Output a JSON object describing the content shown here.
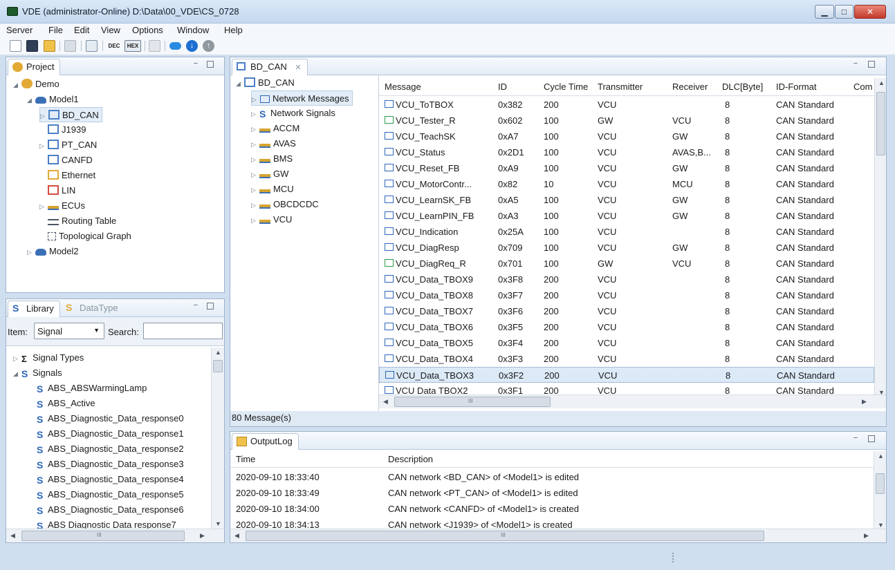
{
  "window": {
    "title": "VDE (administrator-Online)  D:\\Data\\00_VDE\\CS_0728"
  },
  "menubar": [
    "Server",
    "File",
    "Edit",
    "View",
    "Options",
    "Window",
    "Help"
  ],
  "toolbar": {
    "dec_label": "DEC",
    "hex_label": "HEX"
  },
  "project": {
    "tab_label": "Project",
    "items": [
      {
        "label": "Demo",
        "expander": "◢"
      },
      {
        "label": "Model1",
        "expander": "◢"
      },
      {
        "label": "BD_CAN",
        "expander": "▷"
      },
      {
        "label": "J1939",
        "expander": ""
      },
      {
        "label": "PT_CAN",
        "expander": "▷"
      },
      {
        "label": "CANFD",
        "expander": ""
      },
      {
        "label": "Ethernet",
        "expander": ""
      },
      {
        "label": "LIN",
        "expander": ""
      },
      {
        "label": "ECUs",
        "expander": "▷"
      },
      {
        "label": "Routing Table",
        "expander": ""
      },
      {
        "label": "Topological Graph",
        "expander": ""
      },
      {
        "label": "Model2",
        "expander": "▷"
      }
    ]
  },
  "library": {
    "tab_label": "Library",
    "datatype_tab_label": "DataType",
    "item_label": "Item:",
    "item_value": "Signal",
    "search_label": "Search:",
    "search_value": "",
    "tree": [
      {
        "label": "Signal Types",
        "expander": "▷"
      },
      {
        "label": "Signals",
        "expander": "◢"
      }
    ],
    "signals": [
      "ABS_ABSWarmingLamp",
      "ABS_Active",
      "ABS_Diagnostic_Data_response0",
      "ABS_Diagnostic_Data_response1",
      "ABS_Diagnostic_Data_response2",
      "ABS_Diagnostic_Data_response3",
      "ABS_Diagnostic_Data_response4",
      "ABS_Diagnostic_Data_response5",
      "ABS_Diagnostic_Data_response6",
      "ABS Diagnostic Data response7"
    ]
  },
  "editor": {
    "tab_label": "BD_CAN",
    "tree_root": "BD_CAN",
    "tree": [
      {
        "label": "Network Messages",
        "expander": "▷"
      },
      {
        "label": "Network Signals",
        "expander": "▷"
      },
      {
        "label": "ACCM",
        "expander": "▷"
      },
      {
        "label": "AVAS",
        "expander": "▷"
      },
      {
        "label": "BMS",
        "expander": "▷"
      },
      {
        "label": "GW",
        "expander": "▷"
      },
      {
        "label": "MCU",
        "expander": "▷"
      },
      {
        "label": "OBCDCDC",
        "expander": "▷"
      },
      {
        "label": "VCU",
        "expander": "▷"
      }
    ],
    "columns": [
      "Message",
      "ID",
      "Cycle Time",
      "Transmitter",
      "Receiver",
      "DLC[Byte]",
      "ID-Format",
      "Com"
    ],
    "rows": [
      {
        "message": "VCU_ToTBOX",
        "id": "0x382",
        "cycle": "200",
        "tx": "VCU",
        "rx": "",
        "dlc": "8",
        "fmt": "CAN Standard"
      },
      {
        "message": "VCU_Tester_R",
        "id": "0x602",
        "cycle": "100",
        "tx": "GW",
        "rx": "VCU",
        "dlc": "8",
        "fmt": "CAN Standard"
      },
      {
        "message": "VCU_TeachSK",
        "id": "0xA7",
        "cycle": "100",
        "tx": "VCU",
        "rx": "GW",
        "dlc": "8",
        "fmt": "CAN Standard"
      },
      {
        "message": "VCU_Status",
        "id": "0x2D1",
        "cycle": "100",
        "tx": "VCU",
        "rx": "AVAS,B...",
        "dlc": "8",
        "fmt": "CAN Standard"
      },
      {
        "message": "VCU_Reset_FB",
        "id": "0xA9",
        "cycle": "100",
        "tx": "VCU",
        "rx": "GW",
        "dlc": "8",
        "fmt": "CAN Standard"
      },
      {
        "message": "VCU_MotorContr...",
        "id": "0x82",
        "cycle": "10",
        "tx": "VCU",
        "rx": "MCU",
        "dlc": "8",
        "fmt": "CAN Standard"
      },
      {
        "message": "VCU_LearnSK_FB",
        "id": "0xA5",
        "cycle": "100",
        "tx": "VCU",
        "rx": "GW",
        "dlc": "8",
        "fmt": "CAN Standard"
      },
      {
        "message": "VCU_LearnPIN_FB",
        "id": "0xA3",
        "cycle": "100",
        "tx": "VCU",
        "rx": "GW",
        "dlc": "8",
        "fmt": "CAN Standard"
      },
      {
        "message": "VCU_Indication",
        "id": "0x25A",
        "cycle": "100",
        "tx": "VCU",
        "rx": "",
        "dlc": "8",
        "fmt": "CAN Standard"
      },
      {
        "message": "VCU_DiagResp",
        "id": "0x709",
        "cycle": "100",
        "tx": "VCU",
        "rx": "GW",
        "dlc": "8",
        "fmt": "CAN Standard"
      },
      {
        "message": "VCU_DiagReq_R",
        "id": "0x701",
        "cycle": "100",
        "tx": "GW",
        "rx": "VCU",
        "dlc": "8",
        "fmt": "CAN Standard"
      },
      {
        "message": "VCU_Data_TBOX9",
        "id": "0x3F8",
        "cycle": "200",
        "tx": "VCU",
        "rx": "",
        "dlc": "8",
        "fmt": "CAN Standard"
      },
      {
        "message": "VCU_Data_TBOX8",
        "id": "0x3F7",
        "cycle": "200",
        "tx": "VCU",
        "rx": "",
        "dlc": "8",
        "fmt": "CAN Standard"
      },
      {
        "message": "VCU_Data_TBOX7",
        "id": "0x3F6",
        "cycle": "200",
        "tx": "VCU",
        "rx": "",
        "dlc": "8",
        "fmt": "CAN Standard"
      },
      {
        "message": "VCU_Data_TBOX6",
        "id": "0x3F5",
        "cycle": "200",
        "tx": "VCU",
        "rx": "",
        "dlc": "8",
        "fmt": "CAN Standard"
      },
      {
        "message": "VCU_Data_TBOX5",
        "id": "0x3F4",
        "cycle": "200",
        "tx": "VCU",
        "rx": "",
        "dlc": "8",
        "fmt": "CAN Standard"
      },
      {
        "message": "VCU_Data_TBOX4",
        "id": "0x3F3",
        "cycle": "200",
        "tx": "VCU",
        "rx": "",
        "dlc": "8",
        "fmt": "CAN Standard"
      },
      {
        "message": "VCU_Data_TBOX3",
        "id": "0x3F2",
        "cycle": "200",
        "tx": "VCU",
        "rx": "",
        "dlc": "8",
        "fmt": "CAN Standard"
      },
      {
        "message": "VCU Data TBOX2",
        "id": "0x3F1",
        "cycle": "200",
        "tx": "VCU",
        "rx": "",
        "dlc": "8",
        "fmt": "CAN Standard"
      }
    ],
    "selected_row_index": 17,
    "status": "80 Message(s)"
  },
  "outputlog": {
    "tab_label": "OutputLog",
    "columns": [
      "Time",
      "Description"
    ],
    "rows": [
      {
        "time": "2020-09-10 18:33:40",
        "desc": "CAN network <BD_CAN> of <Model1> is edited"
      },
      {
        "time": "2020-09-10 18:33:49",
        "desc": "CAN network <PT_CAN> of <Model1> is edited"
      },
      {
        "time": "2020-09-10 18:34:00",
        "desc": "CAN network <CANFD> of <Model1> is created"
      },
      {
        "time": "2020-09-10 18:34:13",
        "desc": "CAN network <J1939> of <Model1> is created"
      }
    ]
  },
  "scroll_grip": "III",
  "colors": {
    "accent": "#3a7bd5",
    "selection": "#dce9f7",
    "window_bg": "#cfdff0",
    "close_red": "#c43a2a",
    "cloud_blue": "#2a8be0",
    "download_blue": "#1c6fd1"
  },
  "icons": {
    "project": "users-icon",
    "model": "car-icon",
    "network": "network-icon",
    "ecu": "ecu-icon",
    "message": "envelope-icon",
    "signal": "signal-icon"
  }
}
